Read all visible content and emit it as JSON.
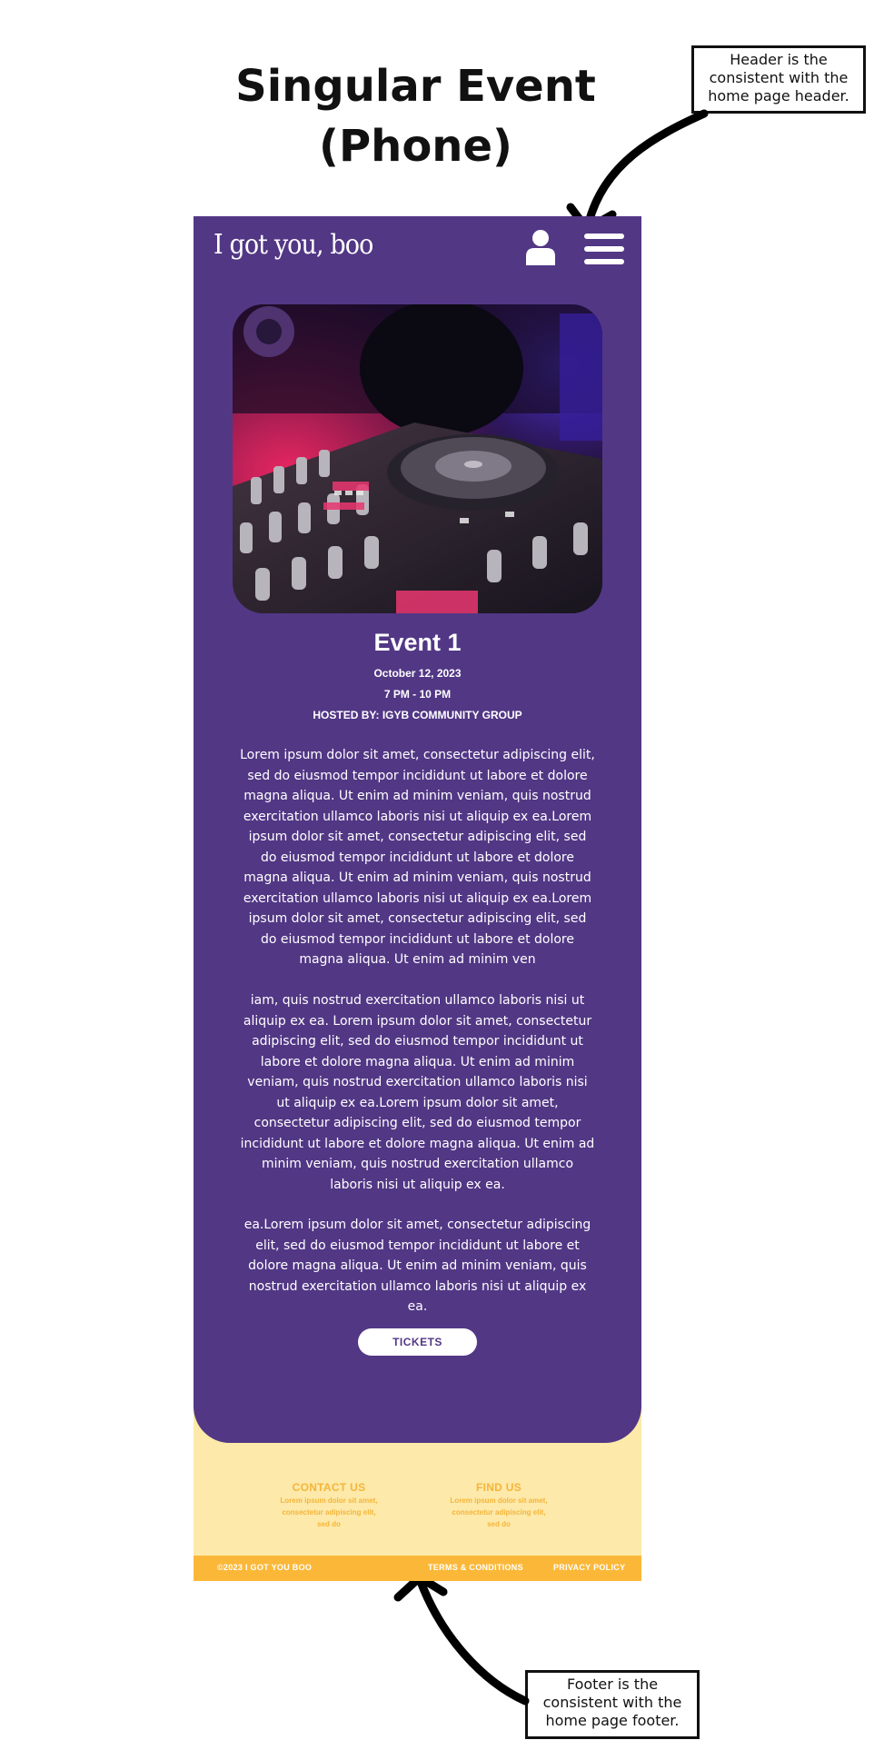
{
  "annotation": {
    "title_line1": "Singular Event",
    "title_line2": "(Phone)",
    "header_note": "Header is the consistent with the home page header.",
    "footer_note": "Footer is the consistent with the home page footer."
  },
  "header": {
    "logo": "I got you, boo",
    "user_icon": "user-icon",
    "menu_icon": "hamburger-menu-icon"
  },
  "event": {
    "image": "dj-turntable-photo",
    "title": "Event 1",
    "date": "October 12, 2023",
    "time": "7 PM - 10 PM",
    "host": "HOSTED BY: IGYB COMMUNITY GROUP",
    "paragraphs": [
      "Lorem ipsum dolor sit amet, consectetur adipiscing elit, sed do eiusmod tempor incididunt ut labore et dolore magna aliqua. Ut enim ad minim veniam, quis nostrud exercitation ullamco laboris nisi ut aliquip ex ea.Lorem ipsum dolor sit amet, consectetur adipiscing elit, sed do eiusmod tempor incididunt ut labore et dolore magna aliqua. Ut enim ad minim veniam, quis nostrud exercitation ullamco laboris nisi ut aliquip ex ea.Lorem ipsum dolor sit amet, consectetur adipiscing elit, sed do eiusmod tempor incididunt ut labore et dolore magna aliqua. Ut enim ad minim ven",
      "iam, quis nostrud exercitation ullamco laboris nisi ut aliquip ex ea. Lorem ipsum dolor sit amet, consectetur adipiscing elit, sed do eiusmod tempor incididunt ut labore et dolore magna aliqua. Ut enim ad minim veniam, quis nostrud exercitation ullamco laboris nisi ut aliquip ex ea.Lorem ipsum dolor sit amet, consectetur adipiscing elit, sed do eiusmod tempor incididunt ut labore et dolore magna aliqua. Ut enim ad minim veniam, quis nostrud exercitation ullamco laboris nisi ut aliquip ex ea.",
      "ea.Lorem ipsum dolor sit amet, consectetur adipiscing elit, sed do eiusmod tempor incididunt ut labore et dolore magna aliqua. Ut enim ad minim veniam, quis nostrud exercitation ullamco laboris nisi ut aliquip ex ea."
    ],
    "tickets_label": "TICKETS"
  },
  "footer": {
    "contact_heading": "CONTACT US",
    "contact_body": "Lorem ipsum dolor sit amet, consectetur adipiscing elit, sed do",
    "find_heading": "FIND US",
    "find_body": "Lorem ipsum dolor sit amet, consectetur adipiscing elit, sed do",
    "copyright": "©2023   I GOT YOU BOO",
    "terms": "TERMS & CONDITIONS",
    "privacy": "PRIVACY POLICY"
  },
  "colors": {
    "purple": "#523785",
    "footer_cream": "#fde9a9",
    "footer_bar": "#fbb838",
    "footer_text": "#f5b53a"
  }
}
